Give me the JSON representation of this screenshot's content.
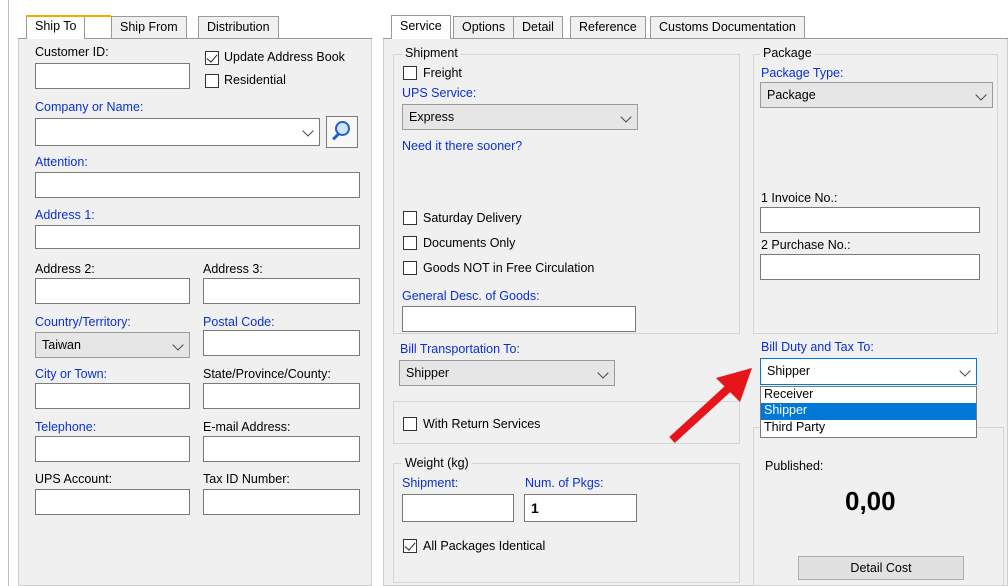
{
  "left_tabs": [
    "Ship To",
    "Ship From",
    "Distribution"
  ],
  "right_tabs": [
    "Service",
    "Options",
    "Detail",
    "Reference",
    "Customs Documentation"
  ],
  "ship_to": {
    "customer_id": "Customer ID:",
    "update_address_book": "Update Address Book",
    "residential": "Residential",
    "company": "Company or Name:",
    "attention": "Attention:",
    "address1": "Address 1:",
    "address2": "Address 2:",
    "address3": "Address 3:",
    "country": "Country/Territory:",
    "country_value": "Taiwan",
    "postal": "Postal Code:",
    "city": "City or Town:",
    "state": "State/Province/County:",
    "telephone": "Telephone:",
    "email": "E-mail Address:",
    "ups_account": "UPS Account:",
    "tax_id": "Tax ID Number:"
  },
  "shipment": {
    "group": "Shipment",
    "freight": "Freight",
    "ups_service": "UPS Service:",
    "service_value": "Express",
    "sooner": "Need it there sooner?",
    "saturday": "Saturday Delivery",
    "documents": "Documents Only",
    "goods_not_free": "Goods NOT in Free Circulation",
    "general_desc": "General Desc. of Goods:"
  },
  "package": {
    "group": "Package",
    "type_label": "Package Type:",
    "type_value": "Package",
    "invoice": "1 Invoice No.:",
    "purchase": "2 Purchase No.:"
  },
  "billing": {
    "transport_label": "Bill Transportation To:",
    "transport_value": "Shipper",
    "duty_label": "Bill Duty and Tax To:",
    "duty_value": "Shipper",
    "duty_options": [
      "Receiver",
      "Shipper",
      "Third Party"
    ]
  },
  "returns": {
    "label": "With Return Services"
  },
  "weight": {
    "group": "Weight (kg)",
    "shipment": "Shipment:",
    "num_pkgs": "Num. of Pkgs:",
    "num_value": "1",
    "identical": "All Packages Identical"
  },
  "cost": {
    "published": "Published:",
    "amount": "0,00",
    "detail_button": "Detail Cost"
  },
  "colors": {
    "arrow": "#e8141b",
    "selection": "#0078d7",
    "link": "#0b2fd4"
  }
}
